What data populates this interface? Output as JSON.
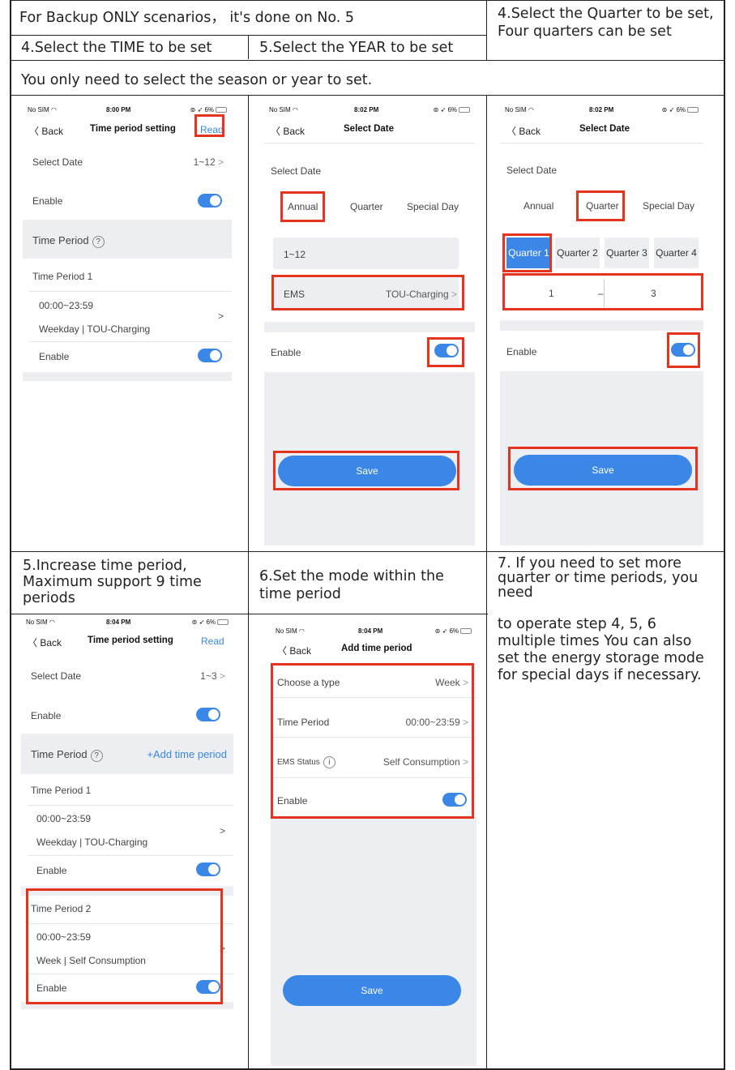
{
  "header": {
    "backup_note": "For Backup ONLY scenarios， it's done on No. 5",
    "step4_time": "4.Select the TIME to be set",
    "step5_year": "5.Select the YEAR to be set",
    "step4_quarter": "4.Select the Quarter to be set, Four quarters can be set",
    "season_note": "You only need to select the season or year to set."
  },
  "captions": {
    "step5_increase": "5.Increase time period, Maximum support 9 time periods",
    "step6_mode": "6.Set the mode within the time period",
    "step7_top": "7. If you need to set more quarter or time periods, you need",
    "step7_rest": "to operate step 4, 5, 6 multiple times You can also set the energy storage mode for special days if necessary."
  },
  "status": {
    "carrier": "No SIM",
    "battery": "6%",
    "time_a": "8:00 PM",
    "time_b": "8:02 PM",
    "time_c": "8:04 PM"
  },
  "screen1": {
    "back": "Back",
    "title": "Time period setting",
    "read": "Read",
    "select_date": "Select Date",
    "select_date_value": "1~12",
    "enable": "Enable",
    "time_period": "Time Period",
    "time_period_1": "Time Period 1",
    "tp1_time": "00:00~23:59",
    "tp1_sub": "Weekday | TOU-Charging",
    "tp1_enable": "Enable"
  },
  "screen2": {
    "back": "Back",
    "title": "Select Date",
    "select_date": "Select Date",
    "tab_annual": "Annual",
    "tab_quarter": "Quarter",
    "tab_special": "Special Day",
    "range": "1~12",
    "ems": "EMS",
    "ems_value": "TOU-Charging",
    "enable": "Enable",
    "save": "Save"
  },
  "screen3": {
    "back": "Back",
    "title": "Select Date",
    "select_date": "Select Date",
    "tab_annual": "Annual",
    "tab_quarter": "Quarter",
    "tab_special": "Special Day",
    "quarters": [
      "Quarter 1",
      "Quarter 2",
      "Quarter 3",
      "Quarter 4"
    ],
    "from": "1",
    "dash": "–",
    "to": "3",
    "enable": "Enable",
    "save": "Save"
  },
  "screen4": {
    "back": "Back",
    "title": "Time period setting",
    "read": "Read",
    "select_date": "Select Date",
    "select_date_value": "1~3",
    "enable": "Enable",
    "time_period": "Time Period",
    "add_time_period": "+Add time period",
    "time_period_1": "Time Period 1",
    "tp1_time": "00:00~23:59",
    "tp1_sub": "Weekday | TOU-Charging",
    "tp1_enable": "Enable",
    "time_period_2": "Time Period 2",
    "tp2_time": "00:00~23:59",
    "tp2_sub": "Week | Self Consumption",
    "tp2_enable": "Enable"
  },
  "screen5": {
    "back": "Back",
    "title": "Add time period",
    "choose_type": "Choose a type",
    "choose_type_value": "Week",
    "time_period": "Time Period",
    "time_period_value": "00:00~23:59",
    "ems_status": "EMS Status",
    "ems_status_value": "Self Consumption",
    "enable": "Enable",
    "save": "Save"
  },
  "colors": {
    "accent": "#3a87e8",
    "highlight": "#e5331f",
    "panel": "#eceef1"
  },
  "icons": [
    "wifi-icon",
    "battery-icon",
    "back-chevron-icon",
    "help-icon",
    "info-icon",
    "toggle-on-icon",
    "chevron-right-icon"
  ]
}
